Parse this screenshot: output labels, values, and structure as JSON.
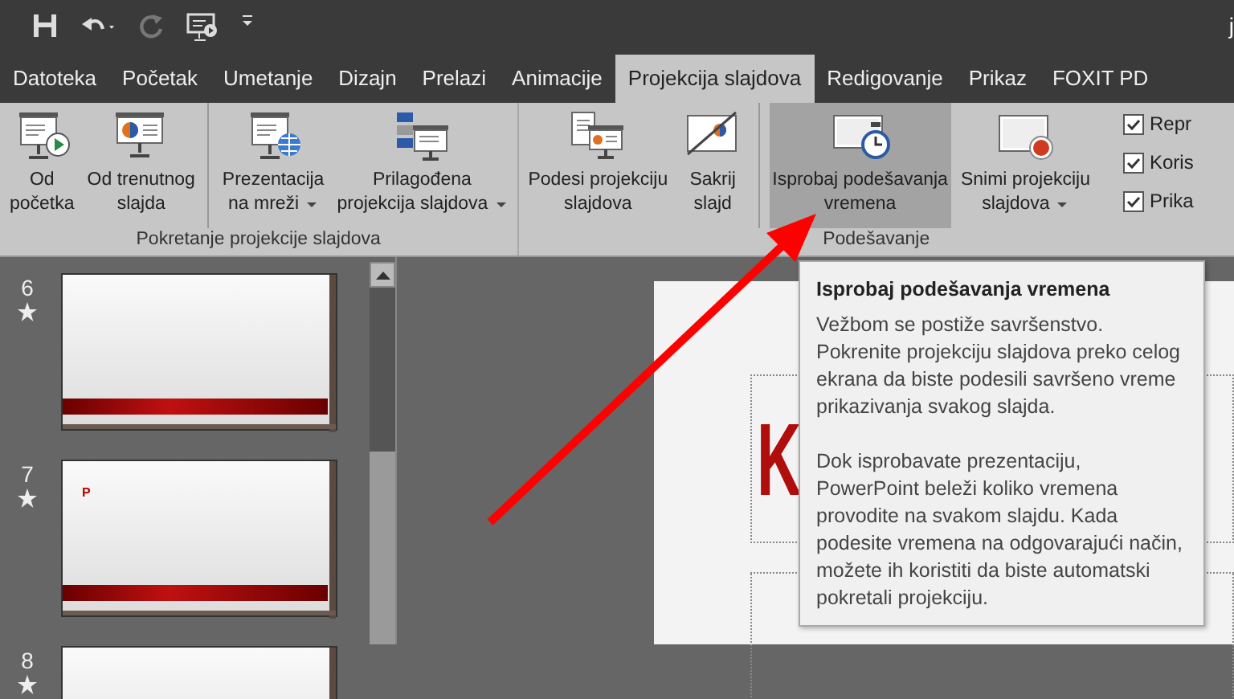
{
  "title_bar": {
    "title_fragment": "j",
    "quick_access": [
      {
        "kind": "save",
        "disabled": false
      },
      {
        "kind": "undo",
        "disabled": false
      },
      {
        "kind": "redo",
        "disabled": true
      },
      {
        "kind": "present",
        "disabled": false
      },
      {
        "kind": "customize",
        "disabled": false
      }
    ]
  },
  "tabs": [
    {
      "label": "Datoteka",
      "selected": false
    },
    {
      "label": "Početak",
      "selected": false
    },
    {
      "label": "Umetanje",
      "selected": false
    },
    {
      "label": "Dizajn",
      "selected": false
    },
    {
      "label": "Prelazi",
      "selected": false
    },
    {
      "label": "Animacije",
      "selected": false
    },
    {
      "label": "Projekcija slajdova",
      "selected": true
    },
    {
      "label": "Redigovanje",
      "selected": false
    },
    {
      "label": "Prikaz",
      "selected": false
    },
    {
      "label": "FOXIT PD",
      "selected": false
    }
  ],
  "ribbon": {
    "groups": [
      {
        "label": "Pokretanje projekcije slajdova",
        "buttons": [
          {
            "kind": "play",
            "lines": [
              "Od",
              "početka"
            ],
            "dropdown": false,
            "hovered": false,
            "separator_after": false
          },
          {
            "kind": "current",
            "lines": [
              "Od trenutnog",
              "slajda"
            ],
            "dropdown": false,
            "hovered": false,
            "separator_after": true
          },
          {
            "kind": "online",
            "lines": [
              "Prezentacija",
              "na mreži"
            ],
            "dropdown": true,
            "hovered": false,
            "separator_after": false
          },
          {
            "kind": "custom",
            "lines": [
              "Prilagođena",
              "projekcija slajdova"
            ],
            "dropdown": true,
            "hovered": false,
            "separator_after": false
          }
        ]
      },
      {
        "label": "Podešavanje",
        "buttons": [
          {
            "kind": "setup",
            "lines": [
              "Podesi projekciju",
              "slajdova"
            ],
            "dropdown": false,
            "hovered": false,
            "separator_after": false
          },
          {
            "kind": "hide",
            "lines": [
              "Sakrij",
              "slajd"
            ],
            "dropdown": false,
            "hovered": false,
            "separator_after": true
          },
          {
            "kind": "rehearse",
            "lines": [
              "Isprobaj podešavanja",
              "vremena"
            ],
            "dropdown": false,
            "hovered": true,
            "separator_after": false
          },
          {
            "kind": "record",
            "lines": [
              "Snimi projekciju",
              "slajdova"
            ],
            "dropdown": true,
            "hovered": false,
            "separator_after": false
          }
        ],
        "checkboxes": [
          {
            "label": "Repr",
            "checked": true
          },
          {
            "label": "Koris",
            "checked": true
          },
          {
            "label": "Prika",
            "checked": true
          }
        ]
      }
    ]
  },
  "slides": [
    {
      "number": "6",
      "animated": true
    },
    {
      "number": "7",
      "animated": true,
      "text": "P"
    },
    {
      "number": "8",
      "animated": true
    }
  ],
  "slide_title_fragment": "K",
  "tooltip": {
    "title": "Isprobaj podešavanja vremena",
    "paragraphs": [
      "Vežbom se postiže savršenstvo. Pokrenite projekciju slajdova preko celog ekrana da biste podesili savršeno vreme prikazivanja svakog slajda.",
      "Dok isprobavate prezentaciju, PowerPoint beleži koliko vremena provodite na svakom slajdu. Kada podesite vremena na odgovarajući način, možete ih koristiti da biste automatski pokretali projekciju."
    ]
  }
}
